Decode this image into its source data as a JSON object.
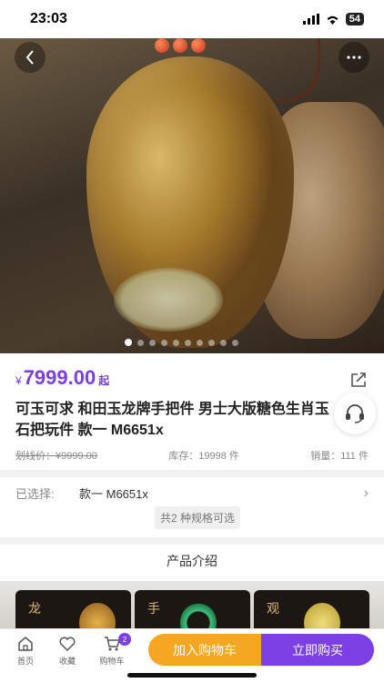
{
  "status_bar": {
    "time": "23:03",
    "battery": "54"
  },
  "product": {
    "price_currency": "¥",
    "price": "7999.00",
    "price_suffix": "起",
    "title": "可玉可求 和田玉龙牌手把件 男士大版糖色生肖玉石把玩件 款一 M6651x",
    "original_price": "划线价：¥9999.00",
    "stock": "库存：19998 件",
    "sales": "销量：111 件",
    "carousel_count": 10,
    "carousel_active": 0
  },
  "spec": {
    "label": "已选择:",
    "value": "款一 M6651x",
    "options_tag": "共2 种规格可选"
  },
  "section_title": "产品介绍",
  "banner_tiles": [
    "龙",
    "手",
    "观"
  ],
  "bottom_bar": {
    "home": "首页",
    "favorite": "收藏",
    "cart": "购物车",
    "cart_badge": "2",
    "add_to_cart": "加入购物车",
    "buy_now": "立即购买"
  },
  "colors": {
    "accent": "#7b3fe4",
    "cart_button": "#f5a623"
  }
}
